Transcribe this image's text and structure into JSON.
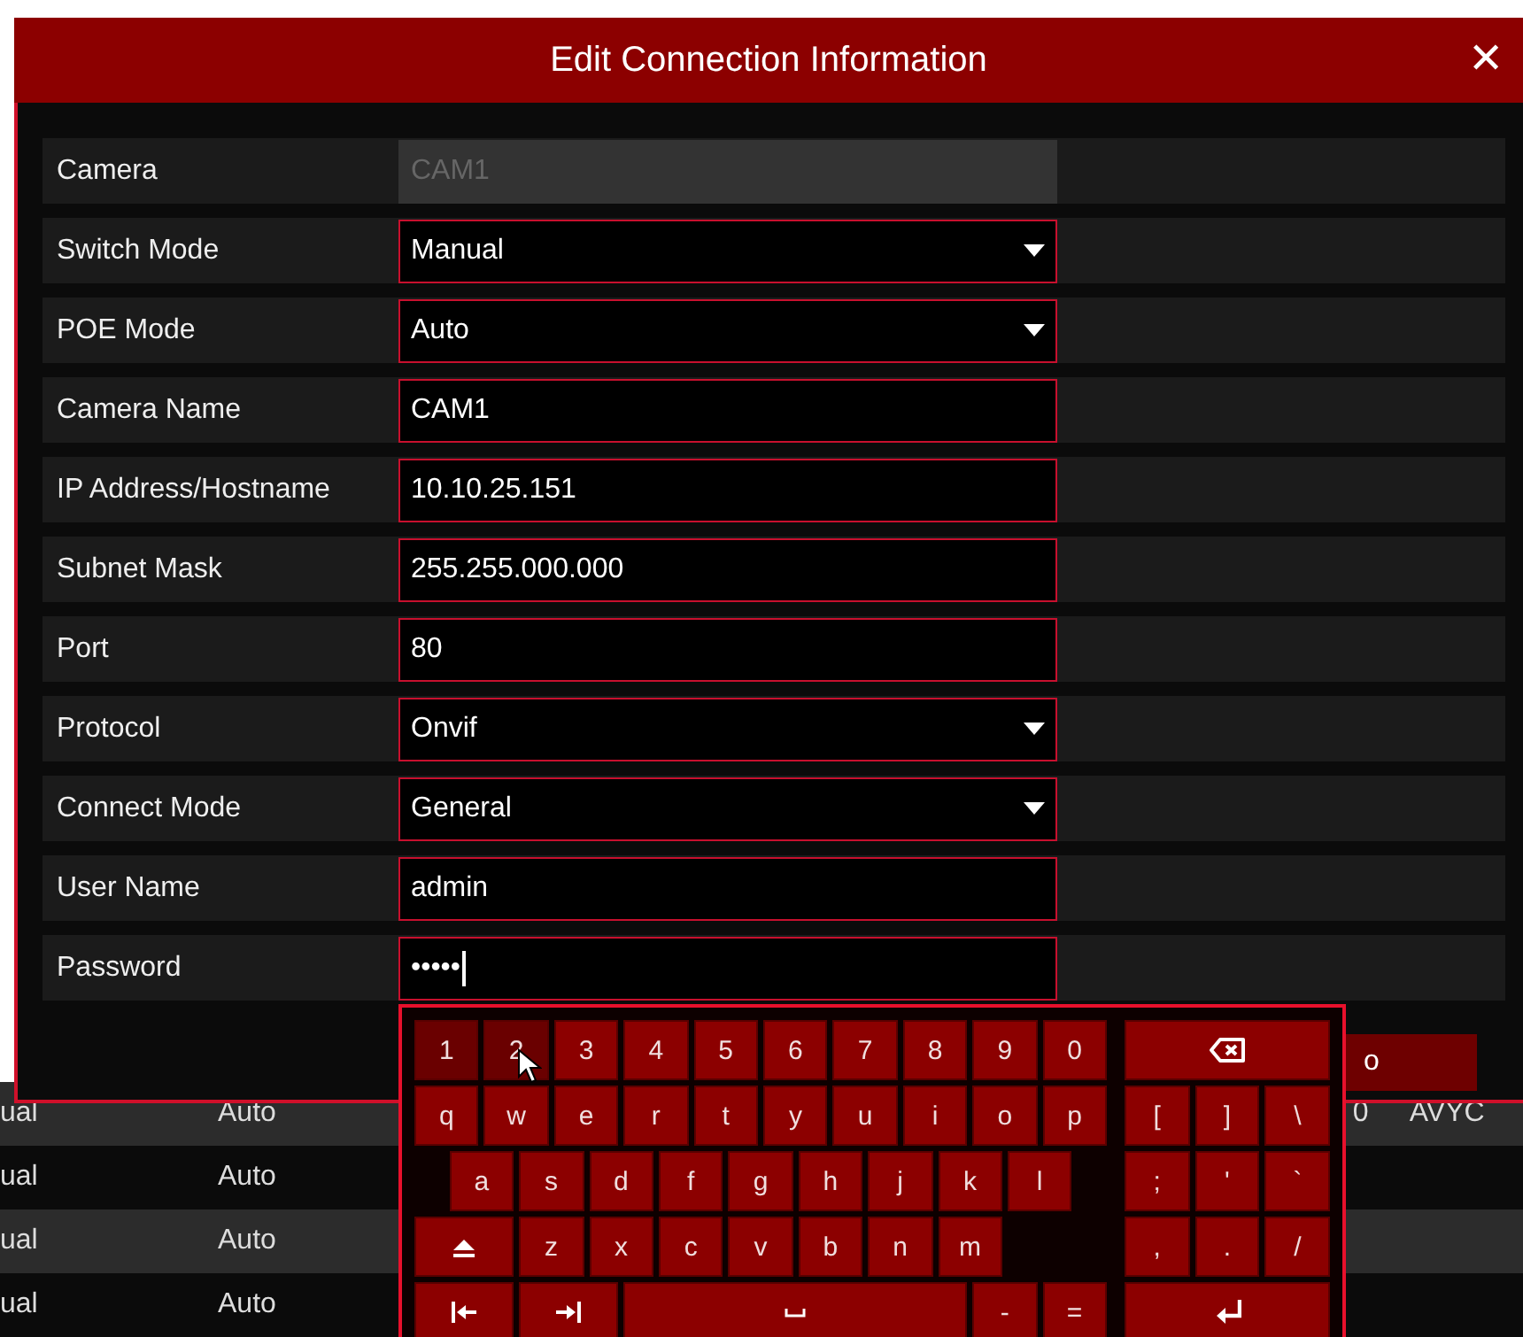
{
  "dialog": {
    "title": "Edit Connection Information",
    "close": "✕",
    "rows": [
      {
        "label": "Camera",
        "kind": "text",
        "value": "CAM1",
        "disabled": true
      },
      {
        "label": "Switch Mode",
        "kind": "select",
        "value": "Manual",
        "disabled": false
      },
      {
        "label": "POE Mode",
        "kind": "select",
        "value": "Auto",
        "disabled": false
      },
      {
        "label": "Camera Name",
        "kind": "text",
        "value": "CAM1",
        "disabled": false
      },
      {
        "label": "IP Address/Hostname",
        "kind": "text",
        "value": "10.10.25.151",
        "disabled": false
      },
      {
        "label": "Subnet Mask",
        "kind": "text",
        "value": "255.255.000.000",
        "disabled": false
      },
      {
        "label": "Port",
        "kind": "text",
        "value": "80",
        "disabled": false
      },
      {
        "label": "Protocol",
        "kind": "select",
        "value": "Onvif",
        "disabled": false
      },
      {
        "label": "Connect Mode",
        "kind": "select",
        "value": "General",
        "disabled": false
      },
      {
        "label": "User Name",
        "kind": "text",
        "value": "admin",
        "disabled": false
      },
      {
        "label": "Password",
        "kind": "password",
        "value": "•••••",
        "disabled": false
      }
    ],
    "button": "o"
  },
  "background_table": {
    "rows": [
      {
        "column_1": "ual",
        "column_2": "Auto",
        "column_3": "0",
        "column_4": "AVYC"
      },
      {
        "column_1": "ual",
        "column_2": "Auto"
      },
      {
        "column_1": "ual",
        "column_2": "Auto"
      },
      {
        "column_1": "ual",
        "column_2": "Auto"
      }
    ]
  },
  "keyboard": {
    "main_rows": [
      {
        "keys": [
          {
            "kind": "char",
            "label": "1",
            "highlighted": true
          },
          {
            "kind": "char",
            "label": "2",
            "highlighted": true
          },
          {
            "kind": "char",
            "label": "3",
            "highlighted": false
          },
          {
            "kind": "char",
            "label": "4",
            "highlighted": false
          },
          {
            "kind": "char",
            "label": "5",
            "highlighted": false
          },
          {
            "kind": "char",
            "label": "6",
            "highlighted": false
          },
          {
            "kind": "char",
            "label": "7",
            "highlighted": false
          },
          {
            "kind": "char",
            "label": "8",
            "highlighted": false
          },
          {
            "kind": "char",
            "label": "9",
            "highlighted": false
          },
          {
            "kind": "char",
            "label": "0",
            "highlighted": false
          }
        ]
      },
      {
        "keys": [
          {
            "kind": "char",
            "label": "q",
            "highlighted": false
          },
          {
            "kind": "char",
            "label": "w",
            "highlighted": false
          },
          {
            "kind": "char",
            "label": "e",
            "highlighted": false
          },
          {
            "kind": "char",
            "label": "r",
            "highlighted": false
          },
          {
            "kind": "char",
            "label": "t",
            "highlighted": false
          },
          {
            "kind": "char",
            "label": "y",
            "highlighted": false
          },
          {
            "kind": "char",
            "label": "u",
            "highlighted": false
          },
          {
            "kind": "char",
            "label": "i",
            "highlighted": false
          },
          {
            "kind": "char",
            "label": "o",
            "highlighted": false
          },
          {
            "kind": "char",
            "label": "p",
            "highlighted": false
          }
        ]
      },
      {
        "keys": [
          {
            "kind": "gap"
          },
          {
            "kind": "char",
            "label": "a",
            "highlighted": false
          },
          {
            "kind": "char",
            "label": "s",
            "highlighted": false
          },
          {
            "kind": "char",
            "label": "d",
            "highlighted": false
          },
          {
            "kind": "char",
            "label": "f",
            "highlighted": false
          },
          {
            "kind": "char",
            "label": "g",
            "highlighted": false
          },
          {
            "kind": "char",
            "label": "h",
            "highlighted": false
          },
          {
            "kind": "char",
            "label": "j",
            "highlighted": false
          },
          {
            "kind": "char",
            "label": "k",
            "highlighted": false
          },
          {
            "kind": "char",
            "label": "l",
            "highlighted": false
          },
          {
            "kind": "gap"
          }
        ]
      },
      {
        "keys": [
          {
            "kind": "shift",
            "highlighted": false
          },
          {
            "kind": "char",
            "label": "z",
            "highlighted": false
          },
          {
            "kind": "char",
            "label": "x",
            "highlighted": false
          },
          {
            "kind": "char",
            "label": "c",
            "highlighted": false
          },
          {
            "kind": "char",
            "label": "v",
            "highlighted": false
          },
          {
            "kind": "char",
            "label": "b",
            "highlighted": false
          },
          {
            "kind": "char",
            "label": "n",
            "highlighted": false
          },
          {
            "kind": "char",
            "label": "m",
            "highlighted": false
          },
          {
            "kind": "gap"
          }
        ]
      },
      {
        "keys": [
          {
            "kind": "backtab",
            "highlighted": false
          },
          {
            "kind": "tab",
            "highlighted": false
          },
          {
            "kind": "space",
            "highlighted": false
          },
          {
            "kind": "char",
            "label": "-",
            "highlighted": false
          },
          {
            "kind": "char",
            "label": "=",
            "highlighted": false
          }
        ]
      }
    ],
    "side_rows": [
      {
        "keys": [
          {
            "kind": "backspace",
            "highlighted": false
          }
        ]
      },
      {
        "keys": [
          {
            "kind": "char",
            "label": "[",
            "highlighted": false
          },
          {
            "kind": "char",
            "label": "]",
            "highlighted": false
          },
          {
            "kind": "char",
            "label": "\\",
            "highlighted": false
          }
        ]
      },
      {
        "keys": [
          {
            "kind": "char",
            "label": ";",
            "highlighted": false
          },
          {
            "kind": "char",
            "label": "'",
            "highlighted": false
          },
          {
            "kind": "char",
            "label": "`",
            "highlighted": false
          }
        ]
      },
      {
        "keys": [
          {
            "kind": "char",
            "label": ",",
            "highlighted": false
          },
          {
            "kind": "char",
            "label": ".",
            "highlighted": false
          },
          {
            "kind": "char",
            "label": "/",
            "highlighted": false
          }
        ]
      },
      {
        "keys": [
          {
            "kind": "enter",
            "highlighted": false
          }
        ]
      }
    ]
  }
}
